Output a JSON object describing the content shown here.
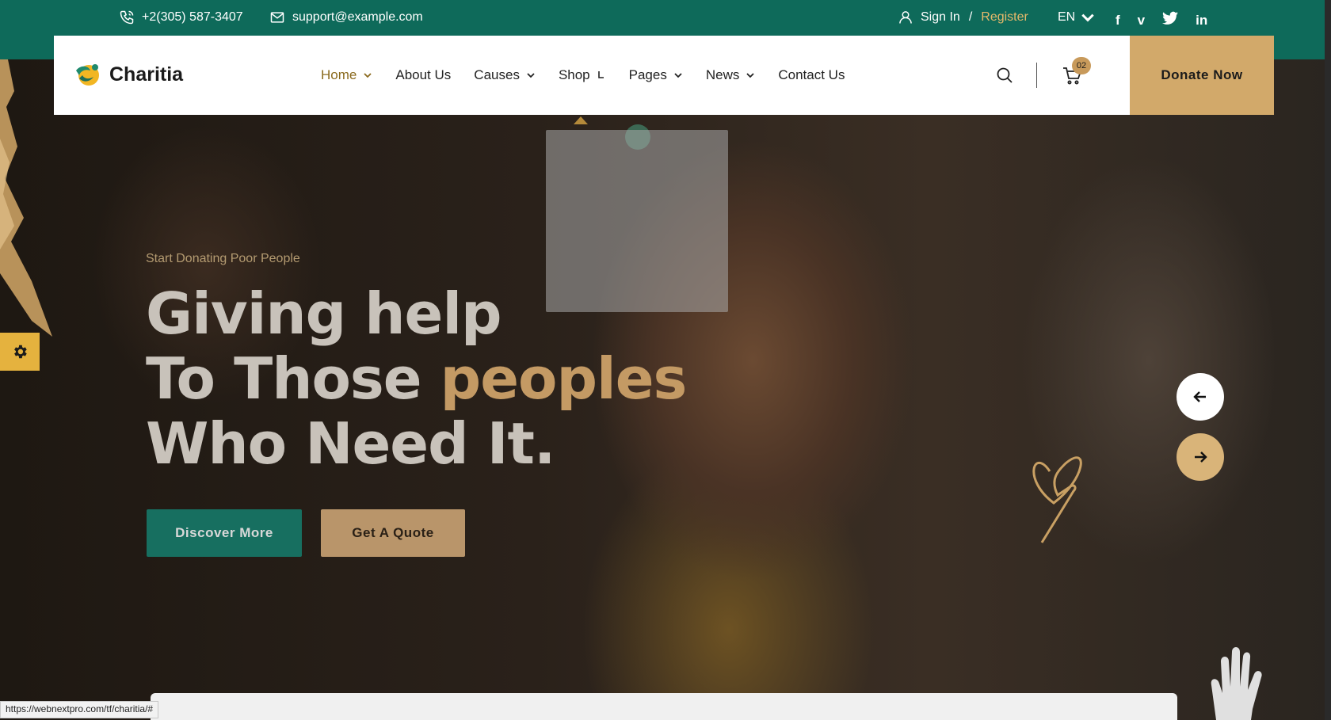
{
  "topbar": {
    "phone": "+2(305) 587-3407",
    "email": "support@example.com",
    "sign_in": "Sign In",
    "separator": "/",
    "register": "Register",
    "language": "EN",
    "social": [
      "f",
      "v",
      "t",
      "in"
    ]
  },
  "brand": {
    "name": "Charitia"
  },
  "nav": {
    "items": [
      {
        "label": "Home",
        "has_dropdown": true,
        "active": true
      },
      {
        "label": "About Us",
        "has_dropdown": false
      },
      {
        "label": "Causes",
        "has_dropdown": true
      },
      {
        "label": "Shop",
        "has_dropdown": false
      },
      {
        "label": "Pages",
        "has_dropdown": true
      },
      {
        "label": "News",
        "has_dropdown": true
      },
      {
        "label": "Contact Us",
        "has_dropdown": false
      }
    ],
    "cart_count": "02",
    "donate_label": "Donate Now"
  },
  "hero": {
    "subtitle": "Start Donating Poor People",
    "title_line1": "Giving help",
    "title_line2_a": "To Those ",
    "title_line2_b": "peoples",
    "title_line3": "Who Need It.",
    "btn_primary": "Discover More",
    "btn_secondary": "Get A Quote"
  },
  "status_url": "https://webnextpro.com/tf/charitia/#",
  "colors": {
    "topbar": "#0e6a5a",
    "accent_gold": "#d2a96a",
    "primary_green": "#176f60"
  },
  "icons": [
    "phone-icon",
    "mail-icon",
    "user-icon",
    "chevron-down-icon",
    "search-icon",
    "cart-icon",
    "gear-icon",
    "arrow-left-icon",
    "arrow-right-icon"
  ]
}
